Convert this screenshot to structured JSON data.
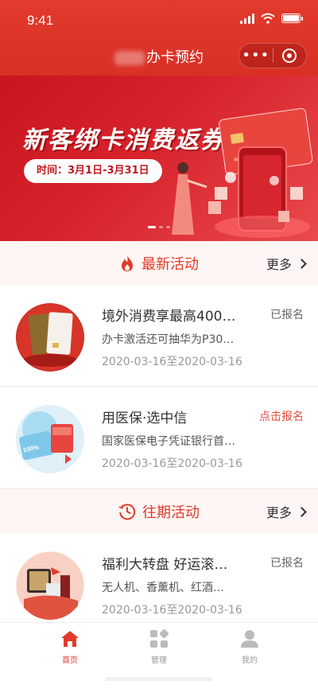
{
  "status_bar": {
    "time": "9:41"
  },
  "nav": {
    "title": "办卡预约"
  },
  "banner": {
    "title": "新客绑卡消费返券",
    "time_label": "时间：3月1日-3月31日"
  },
  "latest_section": {
    "title": "最新活动",
    "more": "更多"
  },
  "past_section": {
    "title": "往期活动",
    "more": "更多"
  },
  "activities": [
    {
      "name": "境外消费享最高400…",
      "desc": "办卡激活还可抽华为P30…",
      "date": "2020-03-16至2020-03-16",
      "status": "已报名"
    },
    {
      "name": "用医保·选中信",
      "desc": "国家医保电子凭证银行首…",
      "date": "2020-03-16至2020-03-16",
      "status": "点击报名"
    },
    {
      "name": "福利大转盘 好运滚…",
      "desc": "无人机、香薰机、红酒…",
      "date": "2020-03-16至2020-03-16",
      "status": "已报名"
    }
  ],
  "tabbar": {
    "items": [
      {
        "label": "首页",
        "icon": "home-icon"
      },
      {
        "label": "管理",
        "icon": "grid-icon"
      },
      {
        "label": "我的",
        "icon": "user-icon"
      }
    ]
  },
  "colors": {
    "brand": "#e23a2c",
    "action": "#e5493b"
  }
}
